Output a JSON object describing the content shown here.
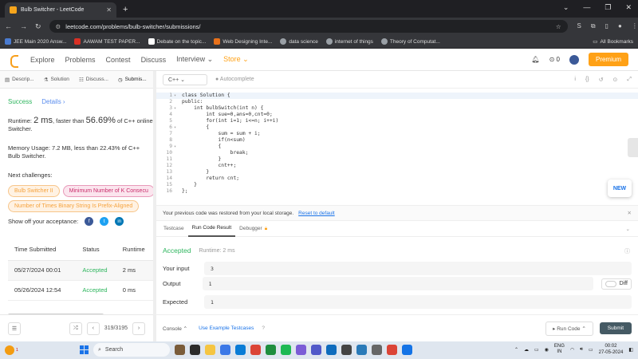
{
  "browser": {
    "tab_title": "Bulb Switcher - LeetCode",
    "new_tab": "+",
    "url": "leetcode.com/problems/bulb-switcher/submissions/",
    "window_controls": [
      "⌄",
      "—",
      "❐",
      "✕"
    ],
    "bookmarks": [
      {
        "label": "JEE Main 2020 Answ...",
        "color": "#4a7bd0"
      },
      {
        "label": "AAWAM TEST PAPER...",
        "color": "#d93025"
      },
      {
        "label": "Debate on the topic...",
        "color": "#ffffff"
      },
      {
        "label": "Web Designing Inte...",
        "color": "#e8711a"
      },
      {
        "label": "data science",
        "color": "#9aa0a6"
      },
      {
        "label": "internet of things",
        "color": "#9aa0a6"
      },
      {
        "label": "Theory of Computat...",
        "color": "#9aa0a6"
      }
    ],
    "all_bookmarks": "All Bookmarks"
  },
  "nav": {
    "links": [
      "Explore",
      "Problems",
      "Contest",
      "Discuss",
      "Interview ⌄",
      "Store ⌄"
    ],
    "notif_count": "0",
    "premium": "Premium"
  },
  "left_tabs": [
    "Descrip...",
    "Solution",
    "Discuss...",
    "Submis..."
  ],
  "result_summary": {
    "status": "Success",
    "details": "Details ›",
    "runtime_prefix": "Runtime: ",
    "runtime_value": "2 ms",
    "runtime_mid": ", faster than ",
    "runtime_pct": "56.69%",
    "runtime_suffix": " of C++ online s",
    "runtime_line2": "Switcher.",
    "memory_prefix": "Memory Usage: ",
    "memory_value": "7.2 MB",
    "memory_mid": ", less than ",
    "memory_pct": "22.43%",
    "memory_suffix": " of C++",
    "memory_line2": "Bulb Switcher.",
    "next_challenges": "Next challenges:",
    "challenges": [
      "Bulb Switcher II",
      "Minimum Number of K Consecu",
      "Number of Times Binary String Is Prefix-Aligned"
    ],
    "show_off": "Show off your acceptance:"
  },
  "submissions": {
    "headers": [
      "Time Submitted",
      "Status",
      "Runtime"
    ],
    "rows": [
      {
        "time": "05/27/2024 00:01",
        "status": "Accepted",
        "runtime": "2 ms"
      },
      {
        "time": "05/26/2024 12:54",
        "status": "Accepted",
        "runtime": "0 ms"
      }
    ]
  },
  "left_bottom": {
    "pager": "319/3195"
  },
  "editor": {
    "language": "C++ ⌄",
    "autocomplete": "● Autocomplete",
    "icons": [
      "i",
      "{}",
      "↺",
      "⊙",
      "⤢"
    ],
    "lines": [
      "class Solution {",
      "public:",
      "    int bulbSwitch(int n) {",
      "        int sue=0,ans=0,cnt=0;",
      "        for(int i=1; i<=n; i++i)",
      "        {",
      "            sum = sum + i;",
      "            if(n<sum)",
      "            {",
      "                break;",
      "            }",
      "            cnt++;",
      "        }",
      "        return cnt;",
      "    }",
      "};"
    ],
    "new_badge": "NEW"
  },
  "restored": {
    "message": "Your previous code was restored from your local storage.",
    "reset": "Reset to default",
    "close": "✕"
  },
  "console_tabs": [
    "Testcase",
    "Run Code Result",
    "Debugger"
  ],
  "run_result": {
    "status": "Accepted",
    "runtime": "Runtime: 2 ms",
    "your_input_label": "Your input",
    "your_input": "3",
    "output_label": "Output",
    "output": "1",
    "expected_label": "Expected",
    "expected": "1",
    "diff": "Diff"
  },
  "editor_bottom": {
    "console": "Console ⌃",
    "example": "Use Example Testcases",
    "run": "▸ Run Code ⌃",
    "submit": "Submit"
  },
  "taskbar": {
    "search": "Search",
    "lang_top": "ENG",
    "lang_bottom": "IN",
    "time": "00:02",
    "date": "27-05-2024",
    "weather_badge": "1"
  },
  "colors": {
    "accent": "#ffa116",
    "success": "#2db55d",
    "link": "#1a73e8"
  }
}
